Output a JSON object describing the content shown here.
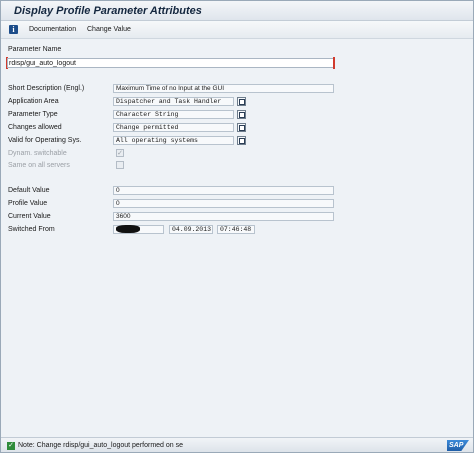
{
  "window": {
    "title": "Display Profile Parameter Attributes"
  },
  "toolbar": {
    "documentation_label": "Documentation",
    "change_value_label": "Change Value"
  },
  "param": {
    "name_label": "Parameter Name",
    "name_value": "rdisp/gui_auto_logout"
  },
  "attributes": {
    "short_desc": {
      "label": "Short Description (Engl.)",
      "value": "Maximum Time of no Input at the GUI"
    },
    "app_area": {
      "label": "Application Area",
      "value": "Dispatcher and Task Handler"
    },
    "param_type": {
      "label": "Parameter Type",
      "value": "Character String"
    },
    "changes_allowed": {
      "label": "Changes allowed",
      "value": "Change permitted"
    },
    "valid_os": {
      "label": "Valid for Operating Sys.",
      "value": "All operating systems"
    },
    "dynamic": {
      "label": "Dynam. switchable",
      "checked": true
    },
    "same_all": {
      "label": "Same on all servers",
      "checked": false
    }
  },
  "values": {
    "default": {
      "label": "Default Value",
      "value": "0"
    },
    "profile": {
      "label": "Profile Value",
      "value": "0"
    },
    "current": {
      "label": "Current Value",
      "value": "3600"
    },
    "switched": {
      "label": "Switched From",
      "date": "04.09.2013",
      "time": "07:46:48"
    }
  },
  "status": {
    "message": "Note: Change rdisp/gui_auto_logout performed on se",
    "brand": "SAP"
  },
  "icons": {
    "info": "info-icon",
    "f4": "value-help-icon",
    "status_ok": "success-check-icon"
  },
  "colors": {
    "accent": "#1d4d8a",
    "success": "#2e8b3a",
    "marker": "#d13b2e"
  }
}
